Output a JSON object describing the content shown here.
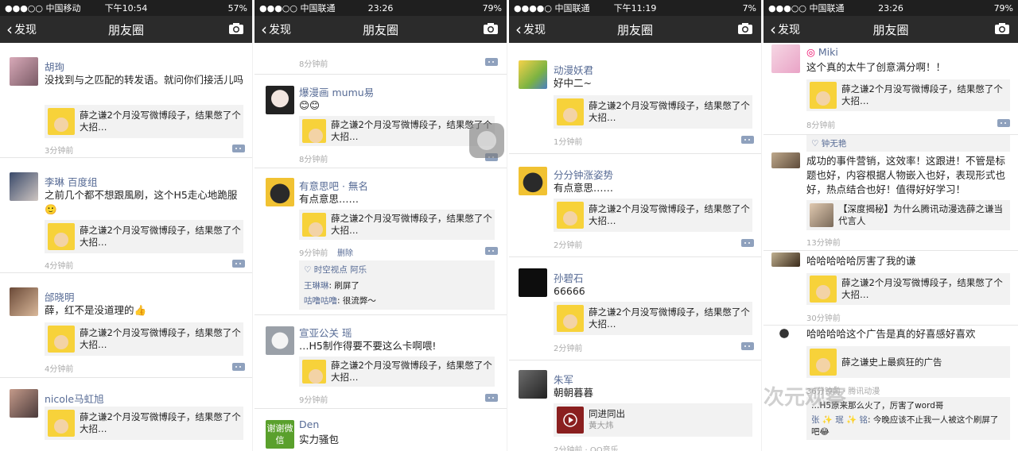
{
  "nav": {
    "back_label": "发现",
    "title": "朋友圈"
  },
  "panels": [
    {
      "status": {
        "carrier": "●●●○○ 中国移动",
        "time": "下午10:54",
        "right": "57%"
      },
      "posts": [
        {
          "name": "胡珣",
          "text": "没找到与之匹配的转发语。就问你们接活儿吗",
          "card": "薛之谦2个月没写微博段子，结果憋了个大招…",
          "time": "3分钟前"
        },
        {
          "name": "李琳 百度组",
          "text": "之前几个都不想跟風刷，这个H5走心地跪服🙂",
          "card": "薛之谦2个月没写微博段子，结果憋了个大招…",
          "time": "4分钟前"
        },
        {
          "name": "邰晓明",
          "text": "薛，红不是没道理的👍",
          "card": "薛之谦2个月没写微博段子，结果憋了个大招…",
          "time": "4分钟前"
        },
        {
          "name": "nicole马虹旭",
          "text": "",
          "card": "薛之谦2个月没写微博段子，结果憋了个大招…",
          "time": ""
        }
      ]
    },
    {
      "status": {
        "carrier": "●●●○○ 中国联通",
        "time": "23:26",
        "right": "79%"
      },
      "posts": [
        {
          "name": "",
          "text": "",
          "card": "",
          "time": "8分钟前"
        },
        {
          "name": "爆漫画 mumu易",
          "text": "😊😊",
          "card": "薛之谦2个月没写微博段子，结果憋了个大招…",
          "time": "8分钟前"
        },
        {
          "name": "有意思吧 · 無名",
          "text": "有点意思……",
          "card": "薛之谦2个月没写微博段子，结果憋了个大招…",
          "time": "9分钟前",
          "delete": "删除",
          "likes": "时空视点 阿乐",
          "comments": [
            {
              "who": "王琳琳",
              "what": "刷屏了"
            },
            {
              "who": "咕噜咕噜",
              "what": "很流弊～"
            }
          ]
        },
        {
          "name": "宣亚公关 瑶",
          "text": "…H5制作得要不要这么卡啊喂!",
          "card": "薛之谦2个月没写微博段子，结果憋了个大招…",
          "time": "9分钟前"
        },
        {
          "name": "Den",
          "text": "实力骚包",
          "card": "",
          "time": "",
          "avatar_text": "谢谢微信"
        }
      ]
    },
    {
      "status": {
        "carrier": "●●●●○ 中国联通",
        "time": "下午11:19",
        "right": "7%"
      },
      "posts": [
        {
          "name": "动漫妖君",
          "text": "好中二~",
          "card": "薛之谦2个月没写微博段子，结果憋了个大招…",
          "time": "1分钟前"
        },
        {
          "name": "分分钟涨姿势",
          "text": "有点意思……",
          "card": "薛之谦2个月没写微博段子，结果憋了个大招…",
          "time": "2分钟前"
        },
        {
          "name": "孙碧石",
          "text": "66666",
          "card": "薛之谦2个月没写微博段子，结果憋了个大招…",
          "time": "2分钟前"
        },
        {
          "name": "朱军",
          "text": "朝朝暮暮",
          "card": "同进同出",
          "card_sub": "黄大炜",
          "time": "2分钟前 · QQ音乐"
        }
      ]
    },
    {
      "status": {
        "carrier": "●●●○○ 中国联通",
        "time": "23:26",
        "right": "79%"
      },
      "posts": [
        {
          "name": "Miki",
          "text": "这个真的太牛了创意满分啊！！",
          "card": "薛之谦2个月没写微博段子，结果憋了个大招…",
          "time": "8分钟前"
        },
        {
          "name": "",
          "likes": "钟无艳",
          "text": "成功的事件营销，这效率！这跟进！不管是标题也好，内容根据人物嵌入也好，表现形式也好，热点结合也好！值得好好学习！",
          "card": "【深度揭秘】为什么腾讯动漫选薛之谦当代言人",
          "time": "13分钟前"
        },
        {
          "name": "",
          "text": "哈哈哈哈哈厉害了我的谦",
          "card": "薛之谦2个月没写微博段子，结果憋了个大招…",
          "time": "30分钟前"
        },
        {
          "name": "",
          "text": "哈哈哈哈这个广告是真的好喜感好喜欢",
          "card": "薛之谦史上最疯狂的广告",
          "time": "36分钟前 · 腾讯动漫",
          "comments": [
            {
              "who": "",
              "what": "…H5原来那么火了，厉害了word哥"
            },
            {
              "who": "张 ✨ 珉 ✨ 铭",
              "what": "今晚应该不止我一人被这个刷屏了吧😂"
            }
          ]
        }
      ]
    }
  ],
  "watermark": "次元观察",
  "icons": {
    "camera": "camera-icon",
    "back": "chevron-left-icon",
    "more": "more-icon",
    "like": "heart-icon"
  },
  "colors": {
    "link": "#576b95",
    "nav": "#2b2b2b",
    "card": "#f2f2f2"
  }
}
